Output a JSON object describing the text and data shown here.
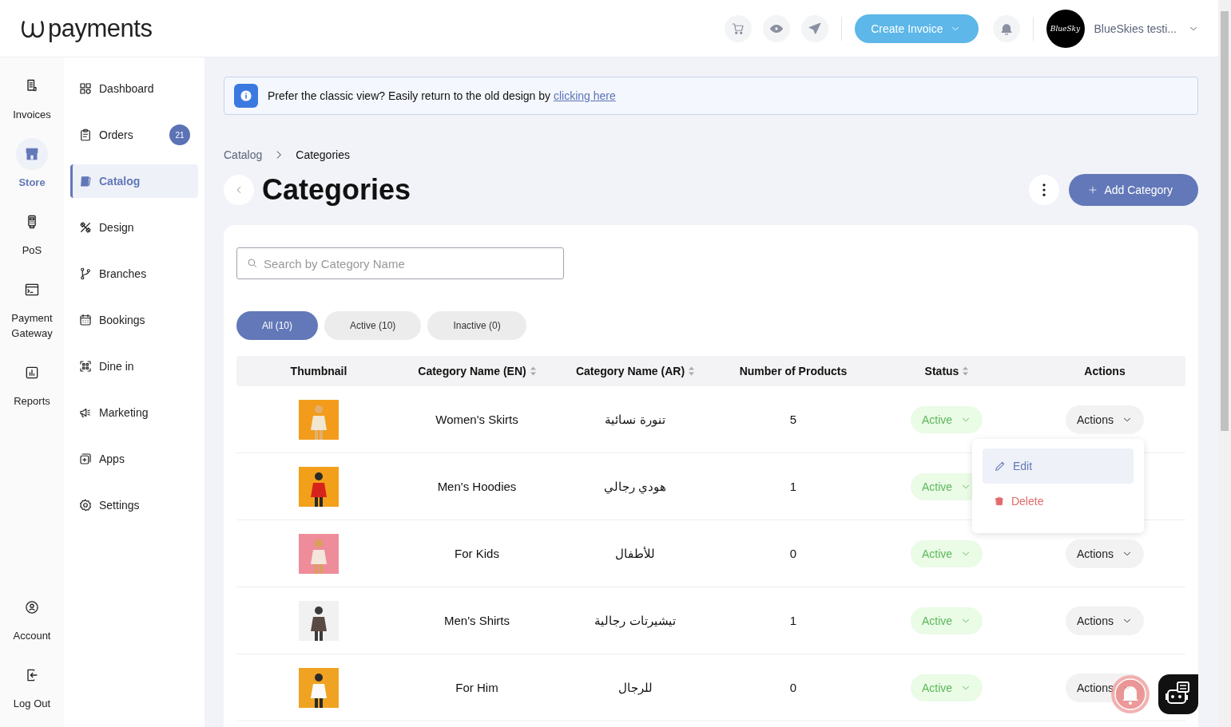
{
  "logo": {
    "text": "payments"
  },
  "header": {
    "create_button": "Create Invoice",
    "user": {
      "avatar_text": "BlueSky",
      "name": "BlueSkies testi..."
    }
  },
  "rail": {
    "items": [
      {
        "label": "Invoices",
        "selected": false
      },
      {
        "label": "Store",
        "selected": true
      },
      {
        "label": "PoS",
        "selected": false
      },
      {
        "label": "Payment Gateway",
        "selected": false
      },
      {
        "label": "Reports",
        "selected": false
      }
    ],
    "bottom_items": [
      {
        "label": "Account"
      },
      {
        "label": "Log Out"
      }
    ]
  },
  "sidebar": {
    "items": [
      {
        "label": "Dashboard",
        "selected": false
      },
      {
        "label": "Orders",
        "selected": false,
        "badge": "21"
      },
      {
        "label": "Catalog",
        "selected": true
      },
      {
        "label": "Design",
        "selected": false
      },
      {
        "label": "Branches",
        "selected": false
      },
      {
        "label": "Bookings",
        "selected": false
      },
      {
        "label": "Dine in",
        "selected": false
      },
      {
        "label": "Marketing",
        "selected": false
      },
      {
        "label": "Apps",
        "selected": false
      },
      {
        "label": "Settings",
        "selected": false
      }
    ]
  },
  "banner": {
    "text": "Prefer the classic view? Easily return to the old design by ",
    "link": "clicking here"
  },
  "breadcrumb": [
    "Catalog",
    "Categories"
  ],
  "title": "Categories",
  "add_button": "Add Category",
  "search": {
    "placeholder": "Search by Category Name"
  },
  "filters": [
    {
      "label": "All (10)",
      "selected": true
    },
    {
      "label": "Active (10)",
      "selected": false
    },
    {
      "label": "Inactive (0)",
      "selected": false
    }
  ],
  "table": {
    "columns": [
      {
        "label": "Thumbnail",
        "sortable": false
      },
      {
        "label": "Category Name (EN)",
        "sortable": true
      },
      {
        "label": "Category Name (AR)",
        "sortable": true
      },
      {
        "label": "Number of Products",
        "sortable": false
      },
      {
        "label": "Status",
        "sortable": true
      },
      {
        "label": "Actions",
        "sortable": false
      }
    ],
    "rows": [
      {
        "name_en": "Women's Skirts",
        "name_ar": "تنورة نسائية",
        "products": "5",
        "status": "Active",
        "actions": "Actions",
        "menu": {
          "items": [
            {
              "label": "Edit",
              "kind": "edit",
              "selected": true
            },
            {
              "label": "Delete",
              "kind": "delete",
              "selected": false
            }
          ]
        }
      },
      {
        "name_en": "Men's Hoodies",
        "name_ar": "هودي رجالي",
        "products": "1",
        "status": "Active"
      },
      {
        "name_en": "For Kids",
        "name_ar": "للأطفال",
        "products": "0",
        "status": "Active",
        "actions": "Actions"
      },
      {
        "name_en": "Men's Shirts",
        "name_ar": "تيشيرتات رجالية",
        "products": "1",
        "status": "Active",
        "actions": "Actions"
      },
      {
        "name_en": "For Him",
        "name_ar": "للرجال",
        "products": "0",
        "status": "Active",
        "actions": "Actions"
      }
    ]
  }
}
